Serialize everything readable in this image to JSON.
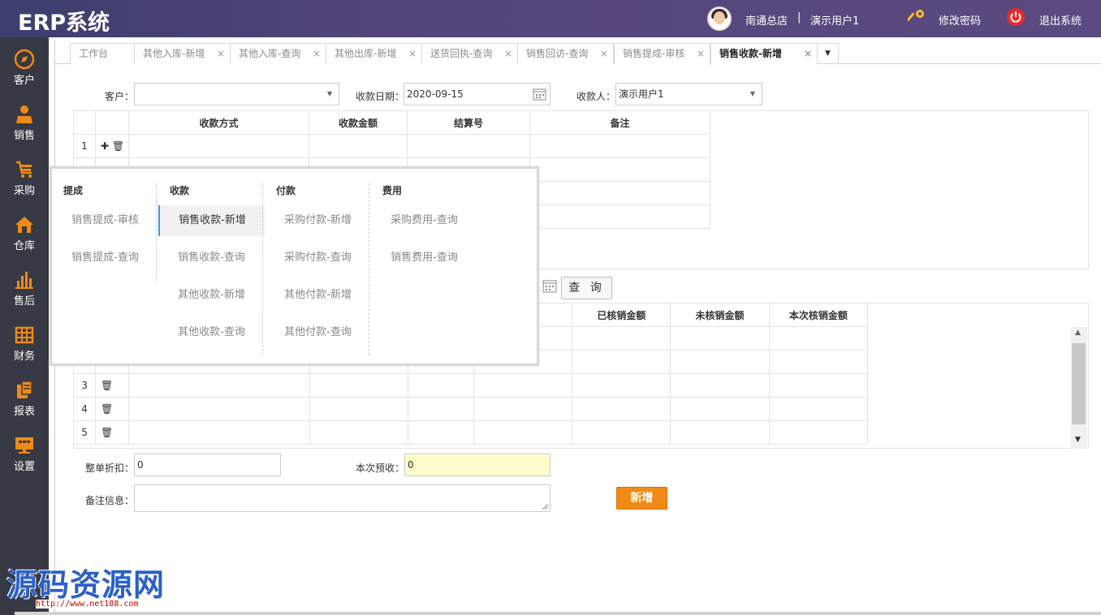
{
  "header": {
    "logo": "ERP系统",
    "store": "南通总店",
    "separator": "|",
    "user": "演示用户1",
    "change_password": "修改密码",
    "logout": "退出系统"
  },
  "sidebar": {
    "items": [
      {
        "label": "客户",
        "icon": "compass-icon"
      },
      {
        "label": "销售",
        "icon": "salesperson-icon"
      },
      {
        "label": "采购",
        "icon": "cart-icon"
      },
      {
        "label": "仓库",
        "icon": "house-icon"
      },
      {
        "label": "售后",
        "icon": "bar-chart-icon"
      },
      {
        "label": "财务",
        "icon": "ledger-icon"
      },
      {
        "label": "报表",
        "icon": "report-icon"
      },
      {
        "label": "设置",
        "icon": "monitor-icon"
      }
    ]
  },
  "tabs": [
    {
      "label": "工作台"
    },
    {
      "label": "其他入库-新增"
    },
    {
      "label": "其他入库-查询"
    },
    {
      "label": "其他出库-新增"
    },
    {
      "label": "送货回执-查询"
    },
    {
      "label": "销售回访-查询"
    },
    {
      "label": "销售提成-审核"
    },
    {
      "label": "销售收款-新增"
    }
  ],
  "tab_close": "×",
  "form": {
    "customer_label": "客户：",
    "customer_value": "",
    "date_label": "收款日期：",
    "date_value": "2020-09-15",
    "payee_label": "收款人：",
    "payee_value": "演示用户1"
  },
  "payment_table": {
    "headers": [
      "收款方式",
      "收款金额",
      "结算号",
      "备注"
    ],
    "rows": [
      "1"
    ]
  },
  "verify_table": {
    "headers": [
      "已核销金额",
      "未核销金额",
      "本次核销金额"
    ],
    "rows": [
      "3",
      "4",
      "5"
    ]
  },
  "query_button": "查 询",
  "bottom_form": {
    "discount_label": "整单折扣：",
    "discount_value": "0",
    "prepay_label": "本次预收：",
    "prepay_value": "0",
    "remark_label": "备注信息：",
    "remark_value": ""
  },
  "add_button": "新增",
  "popup": {
    "columns": [
      {
        "title": "提成",
        "items": [
          "销售提成-审核",
          "销售提成-查询"
        ]
      },
      {
        "title": "收款",
        "items": [
          "销售收款-新增",
          "销售收款-查询",
          "其他收款-新增",
          "其他收款-查询"
        ]
      },
      {
        "title": "付款",
        "items": [
          "采购付款-新增",
          "采购付款-查询",
          "其他付款-新增",
          "其他付款-查询"
        ]
      },
      {
        "title": "费用",
        "items": [
          "采购费用-查询",
          "销售费用-查询"
        ]
      }
    ]
  },
  "watermark": {
    "text": "源码资源网",
    "url": "http://www.net188.com"
  }
}
